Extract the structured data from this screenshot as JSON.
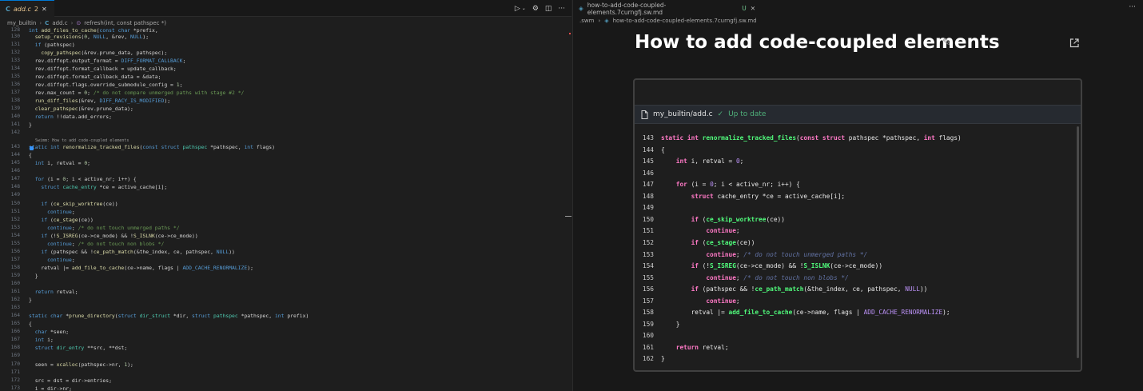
{
  "left": {
    "tab": {
      "icon": "C",
      "filename": "add.c",
      "badge": "2",
      "close": "✕"
    },
    "toolbar_icons": [
      "run-icon",
      "chevron-down-icon",
      "gear-icon",
      "split-editor-icon",
      "more-icon"
    ],
    "breadcrumb": {
      "folder": "my_builtin",
      "file_icon": "C",
      "file": "add.c",
      "symbol": "refresh(int, const pathspec *)"
    },
    "codelens": "Swimm: How to add code-coupled elements",
    "lines": [
      {
        "n": "128",
        "t": "int add_files_to_cache(const char *prefix,"
      },
      {
        "n": "130",
        "t": "  setup_revisions(0, NULL, &rev, NULL);"
      },
      {
        "n": "131",
        "t": "  if (pathspec)"
      },
      {
        "n": "132",
        "t": "    copy_pathspec(&rev.prune_data, pathspec);"
      },
      {
        "n": "133",
        "t": "  rev.diffopt.output_format = DIFF_FORMAT_CALLBACK;"
      },
      {
        "n": "134",
        "t": "  rev.diffopt.format_callback = update_callback;"
      },
      {
        "n": "135",
        "t": "  rev.diffopt.format_callback_data = &data;"
      },
      {
        "n": "136",
        "t": "  rev.diffopt.flags.override_submodule_config = 1;"
      },
      {
        "n": "137",
        "t": "  rev.max_count = 0; /* do not compare unmerged paths with stage #2 */"
      },
      {
        "n": "138",
        "t": "  run_diff_files(&rev, DIFF_RACY_IS_MODIFIED);"
      },
      {
        "n": "139",
        "t": "  clear_pathspec(&rev.prune_data);"
      },
      {
        "n": "140",
        "t": "  return !!data.add_errors;"
      },
      {
        "n": "141",
        "t": "}"
      },
      {
        "n": "142",
        "t": ""
      },
      {
        "n": "143",
        "t": "static int renormalize_tracked_files(const struct pathspec *pathspec, int flags)"
      },
      {
        "n": "144",
        "t": "{"
      },
      {
        "n": "145",
        "t": "  int i, retval = 0;"
      },
      {
        "n": "146",
        "t": ""
      },
      {
        "n": "147",
        "t": "  for (i = 0; i < active_nr; i++) {"
      },
      {
        "n": "148",
        "t": "    struct cache_entry *ce = active_cache[i];"
      },
      {
        "n": "149",
        "t": ""
      },
      {
        "n": "150",
        "t": "    if (ce_skip_worktree(ce))"
      },
      {
        "n": "151",
        "t": "      continue;"
      },
      {
        "n": "152",
        "t": "    if (ce_stage(ce))"
      },
      {
        "n": "153",
        "t": "      continue; /* do not touch unmerged paths */"
      },
      {
        "n": "154",
        "t": "    if (!S_ISREG(ce->ce_mode) && !S_ISLNK(ce->ce_mode))"
      },
      {
        "n": "155",
        "t": "      continue; /* do not touch non blobs */"
      },
      {
        "n": "156",
        "t": "    if (pathspec && !ce_path_match(&the_index, ce, pathspec, NULL))"
      },
      {
        "n": "157",
        "t": "      continue;"
      },
      {
        "n": "158",
        "t": "    retval |= add_file_to_cache(ce->name, flags | ADD_CACHE_RENORMALIZE);"
      },
      {
        "n": "159",
        "t": "  }"
      },
      {
        "n": "160",
        "t": ""
      },
      {
        "n": "161",
        "t": "  return retval;"
      },
      {
        "n": "162",
        "t": "}"
      },
      {
        "n": "163",
        "t": ""
      },
      {
        "n": "164",
        "t": "static char *prune_directory(struct dir_struct *dir, struct pathspec *pathspec, int prefix)"
      },
      {
        "n": "165",
        "t": "{"
      },
      {
        "n": "166",
        "t": "  char *seen;"
      },
      {
        "n": "167",
        "t": "  int i;"
      },
      {
        "n": "168",
        "t": "  struct dir_entry **src, **dst;"
      },
      {
        "n": "169",
        "t": ""
      },
      {
        "n": "170",
        "t": "  seen = xcalloc(pathspec->nr, 1);"
      },
      {
        "n": "171",
        "t": ""
      },
      {
        "n": "172",
        "t": "  src = dst = dir->entries;"
      },
      {
        "n": "173",
        "t": "  i = dir->nr;"
      }
    ]
  },
  "right": {
    "tab": {
      "filename": "how-to-add-code-coupled-elements.7curngfj.sw.md",
      "status": "U",
      "close": "✕"
    },
    "more": "···",
    "breadcrumb": {
      "folder": ".swm",
      "file": "how-to-add-code-coupled-elements.7curngfj.sw.md"
    },
    "title": "How to add code-coupled elements",
    "snippet": {
      "path": "my_builtin/add.c",
      "status": "Up to date",
      "lines": [
        {
          "n": "143",
          "t": "static int renormalize_tracked_files(const struct pathspec *pathspec, int flags)"
        },
        {
          "n": "144",
          "t": "{"
        },
        {
          "n": "145",
          "t": "    int i, retval = 0;"
        },
        {
          "n": "146",
          "t": ""
        },
        {
          "n": "147",
          "t": "    for (i = 0; i < active_nr; i++) {"
        },
        {
          "n": "148",
          "t": "        struct cache_entry *ce = active_cache[i];"
        },
        {
          "n": "149",
          "t": ""
        },
        {
          "n": "150",
          "t": "        if (ce_skip_worktree(ce))"
        },
        {
          "n": "151",
          "t": "            continue;"
        },
        {
          "n": "152",
          "t": "        if (ce_stage(ce))"
        },
        {
          "n": "153",
          "t": "            continue; /* do not touch unmerged paths */"
        },
        {
          "n": "154",
          "t": "        if (!S_ISREG(ce->ce_mode) && !S_ISLNK(ce->ce_mode))"
        },
        {
          "n": "155",
          "t": "            continue; /* do not touch non blobs */"
        },
        {
          "n": "156",
          "t": "        if (pathspec && !ce_path_match(&the_index, ce, pathspec, NULL))"
        },
        {
          "n": "157",
          "t": "            continue;"
        },
        {
          "n": "158",
          "t": "        retval |= add_file_to_cache(ce->name, flags | ADD_CACHE_RENORMALIZE);"
        },
        {
          "n": "159",
          "t": "    }"
        },
        {
          "n": "160",
          "t": ""
        },
        {
          "n": "161",
          "t": "    return retval;"
        },
        {
          "n": "162",
          "t": "}"
        }
      ]
    }
  }
}
